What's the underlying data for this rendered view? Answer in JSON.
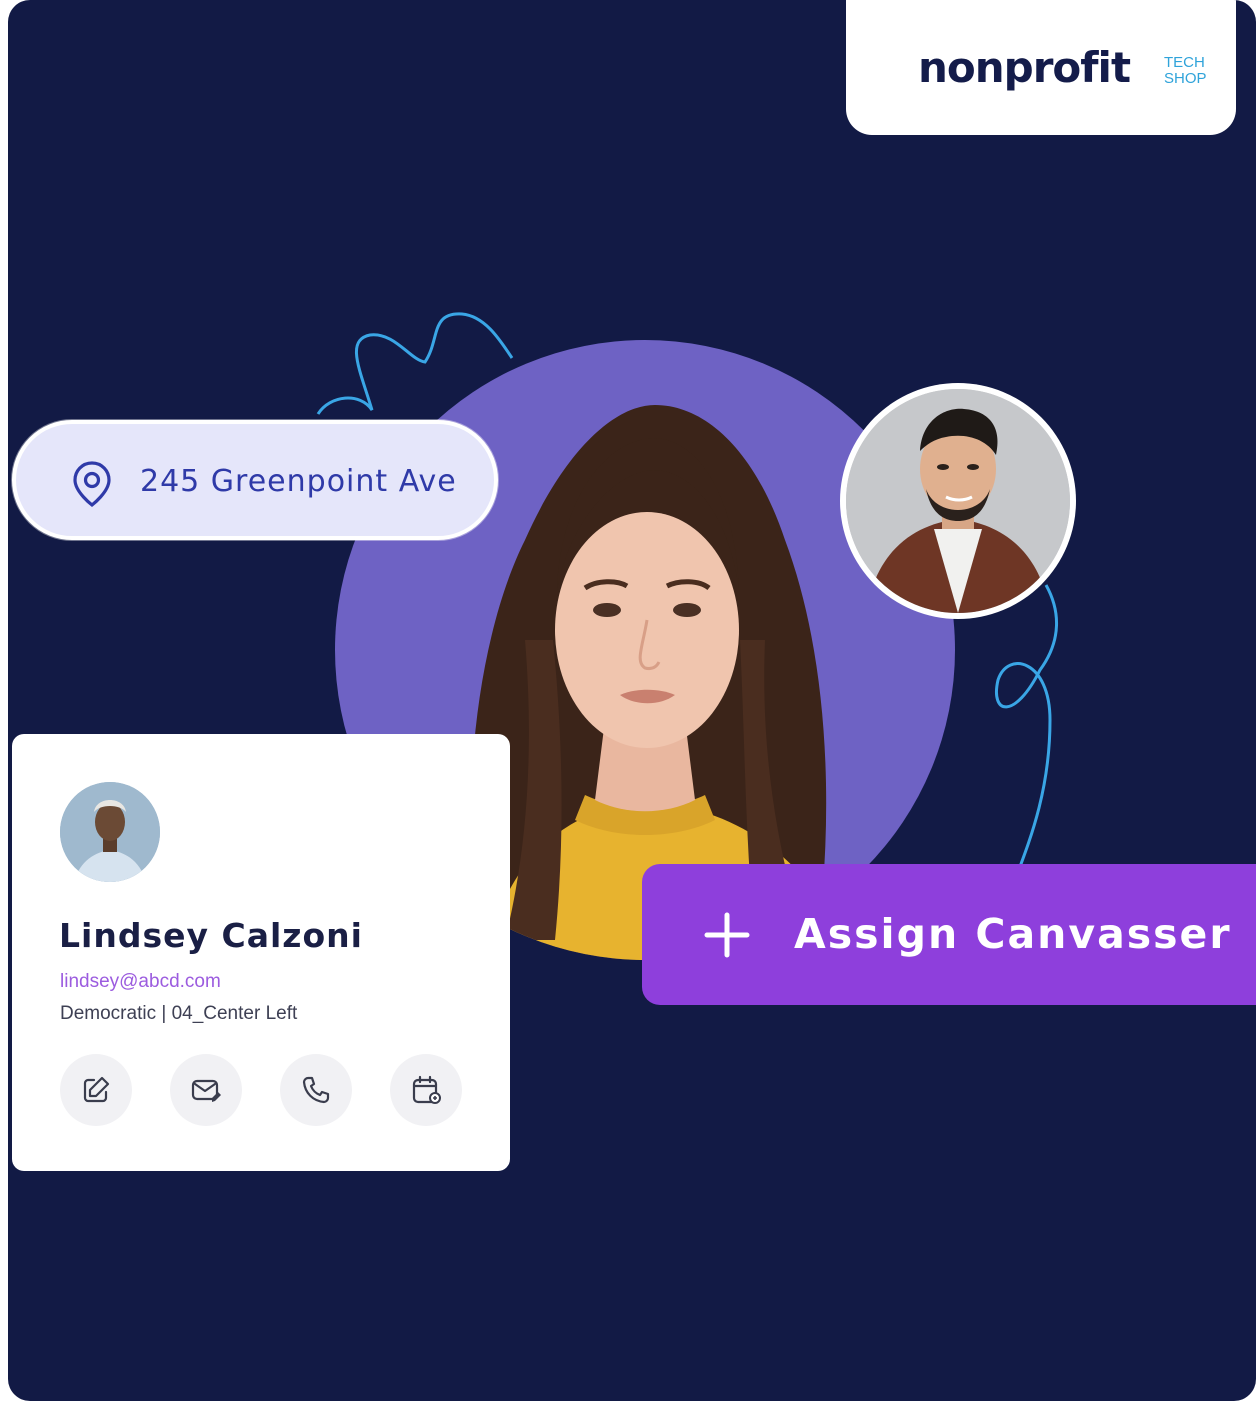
{
  "brand": {
    "wordmark": "nonprofit",
    "sub_line1": "TECH",
    "sub_line2": "SHOP",
    "accent": "#2fa3da",
    "navy": "#141c4a"
  },
  "address_pill": {
    "icon": "location-pin-icon",
    "text": "245 Greenpoint Ave"
  },
  "contact_card": {
    "name": "Lindsey Calzoni",
    "email": "lindsey@abcd.com",
    "meta": "Democratic | 04_Center Left",
    "actions": [
      {
        "icon": "edit-icon"
      },
      {
        "icon": "mail-icon"
      },
      {
        "icon": "phone-icon"
      },
      {
        "icon": "calendar-icon"
      }
    ]
  },
  "assign_button": {
    "icon": "plus-icon",
    "label": "Assign Canvasser",
    "color": "#8e3fdc"
  },
  "colors": {
    "background": "#121a45",
    "circle": "#6e62c4",
    "squiggle": "#3aa6e6"
  }
}
